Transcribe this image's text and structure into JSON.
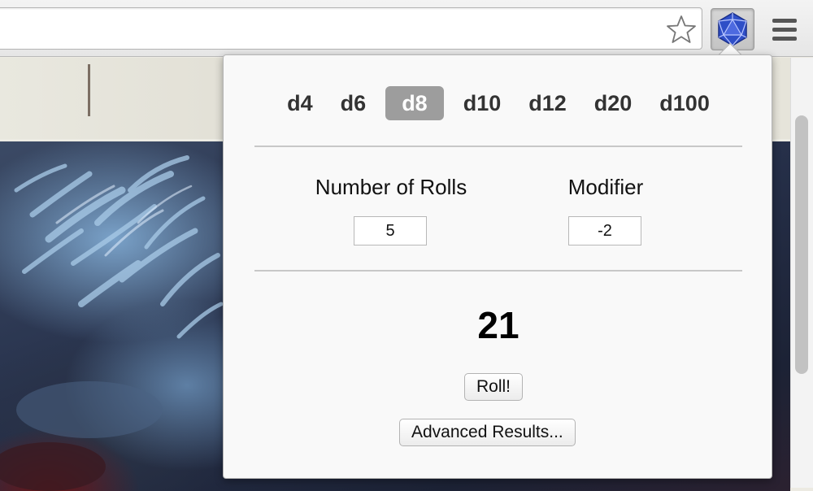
{
  "toolbar": {
    "bookmark_icon": "star-outline-icon",
    "extension_icon": "d20-dice-icon",
    "menu_icon": "hamburger-menu-icon"
  },
  "popup": {
    "dice": [
      {
        "label": "d4",
        "selected": false
      },
      {
        "label": "d6",
        "selected": false
      },
      {
        "label": "d8",
        "selected": true
      },
      {
        "label": "d10",
        "selected": false
      },
      {
        "label": "d12",
        "selected": false
      },
      {
        "label": "d20",
        "selected": false
      },
      {
        "label": "d100",
        "selected": false
      }
    ],
    "rolls_label": "Number of Rolls",
    "rolls_value": "5",
    "modifier_label": "Modifier",
    "modifier_value": "-2",
    "result": "21",
    "roll_button": "Roll!",
    "advanced_button": "Advanced Results..."
  },
  "colors": {
    "selected_die_bg": "#9d9d9d",
    "extension_icon_blue": "#2f4fc7"
  }
}
